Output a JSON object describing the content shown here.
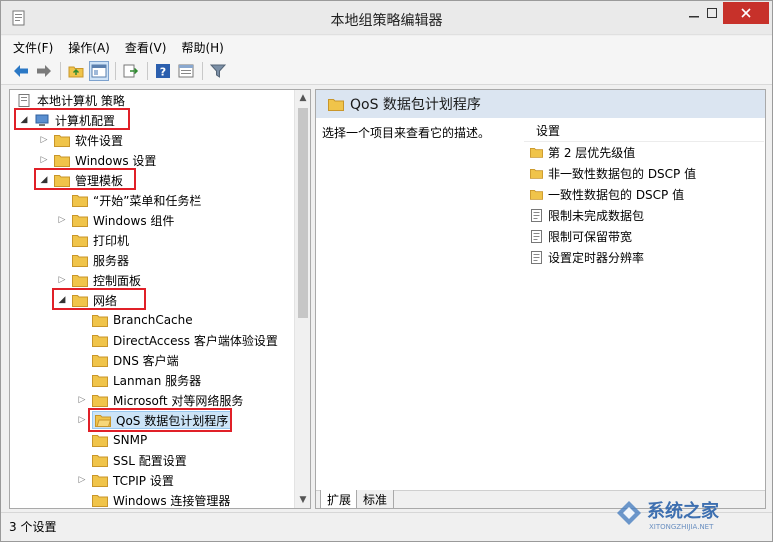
{
  "window": {
    "title": "本地组策略编辑器"
  },
  "menu": [
    {
      "label": "文件(F)"
    },
    {
      "label": "操作(A)"
    },
    {
      "label": "查看(V)"
    },
    {
      "label": "帮助(H)"
    }
  ],
  "tree": {
    "root": "本地计算机 策略",
    "computer_config": "计算机配置",
    "software_settings": "软件设置",
    "windows_settings": "Windows 设置",
    "admin_templates": "管理模板",
    "start_menu": "“开始”菜单和任务栏",
    "windows_components": "Windows 组件",
    "printers": "打印机",
    "server": "服务器",
    "control_panel": "控制面板",
    "network": "网络",
    "branchcache": "BranchCache",
    "directaccess": "DirectAccess 客户端体验设置",
    "dns_client": "DNS 客户端",
    "lanman_server": "Lanman 服务器",
    "ms_p2p": "Microsoft 对等网络服务",
    "qos": "QoS 数据包计划程序",
    "snmp": "SNMP",
    "ssl": "SSL 配置设置",
    "tcpip": "TCPIP 设置",
    "windows_conn_mgr": "Windows 连接管理器"
  },
  "right": {
    "header_title": "QoS 数据包计划程序",
    "description": "选择一个项目来查看它的描述。",
    "column_header": "设置",
    "settings": [
      {
        "label": "第 2 层优先级值",
        "type": "folder"
      },
      {
        "label": "非一致性数据包的 DSCP 值",
        "type": "folder"
      },
      {
        "label": "一致性数据包的 DSCP 值",
        "type": "folder"
      },
      {
        "label": "限制未完成数据包",
        "type": "policy"
      },
      {
        "label": "限制可保留带宽",
        "type": "policy"
      },
      {
        "label": "设置定时器分辨率",
        "type": "policy"
      }
    ],
    "tabs": {
      "extended": "扩展",
      "standard": "标准"
    }
  },
  "status": {
    "text": "3 个设置"
  },
  "watermark": {
    "text": "系统之家",
    "url": "XITONGZHIJIA.NET"
  },
  "colors": {
    "highlight_box": "#e02028",
    "folder": "#f0c44a",
    "header_bg": "#dbe5f1",
    "close_button": "#c7312a"
  }
}
